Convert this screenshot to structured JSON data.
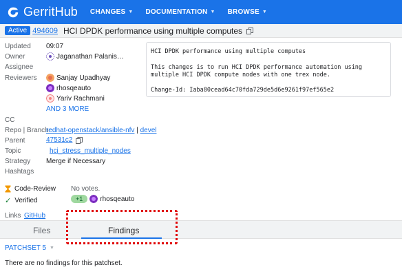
{
  "app": {
    "name": "GerritHub"
  },
  "nav": {
    "items": [
      {
        "label": "CHANGES"
      },
      {
        "label": "DOCUMENTATION"
      },
      {
        "label": "BROWSE"
      }
    ]
  },
  "change": {
    "status": "Active",
    "number": "494609",
    "subject": "HCI DPDK performance using multiple computes"
  },
  "meta": {
    "updated_label": "Updated",
    "updated": "09:07",
    "owner_label": "Owner",
    "owner": "Jaganathan Palanis…",
    "assignee_label": "Assignee",
    "reviewers_label": "Reviewers",
    "reviewers": [
      "Sanjay Upadhyay",
      "rhosqeauto",
      "Yariv Rachmani"
    ],
    "more_reviewers": "AND 3 MORE",
    "cc_label": "CC",
    "repo_label": "Repo | Branch",
    "repo": "redhat-openstack/ansible-nfv",
    "branch_sep": " | ",
    "branch": "devel",
    "parent_label": "Parent",
    "parent": "47531c2",
    "topic_label": "Topic",
    "topic": "hci_stress_multiple_nodes",
    "strategy_label": "Strategy",
    "strategy": "Merge if Necessary",
    "hashtags_label": "Hashtags"
  },
  "commit_message": "HCI DPDK performance using multiple computes\n\nThis changes is to run HCI DPDK performance automation using\nmultiple HCI DPDK compute nodes with one trex node.\n\nChange-Id: Iaba80cead64c70fda729de5d6e9261f97ef565e2",
  "labels": {
    "code_review_label": "Code-Review",
    "code_review_value": "No votes.",
    "verified_label": "Verified",
    "verified_vote": "+1",
    "verified_voter": "rhosqeauto"
  },
  "links": {
    "label": "Links",
    "github": "GitHub"
  },
  "tabs": [
    {
      "label": "Files"
    },
    {
      "label": "Findings"
    }
  ],
  "findings": {
    "patchset": "PATCHSET 5",
    "empty_message": "There are no findings for this patchset."
  },
  "colors": {
    "brand": "#1a73e8",
    "highlight": "#e00000",
    "vote_positive": "#9fd89f"
  }
}
